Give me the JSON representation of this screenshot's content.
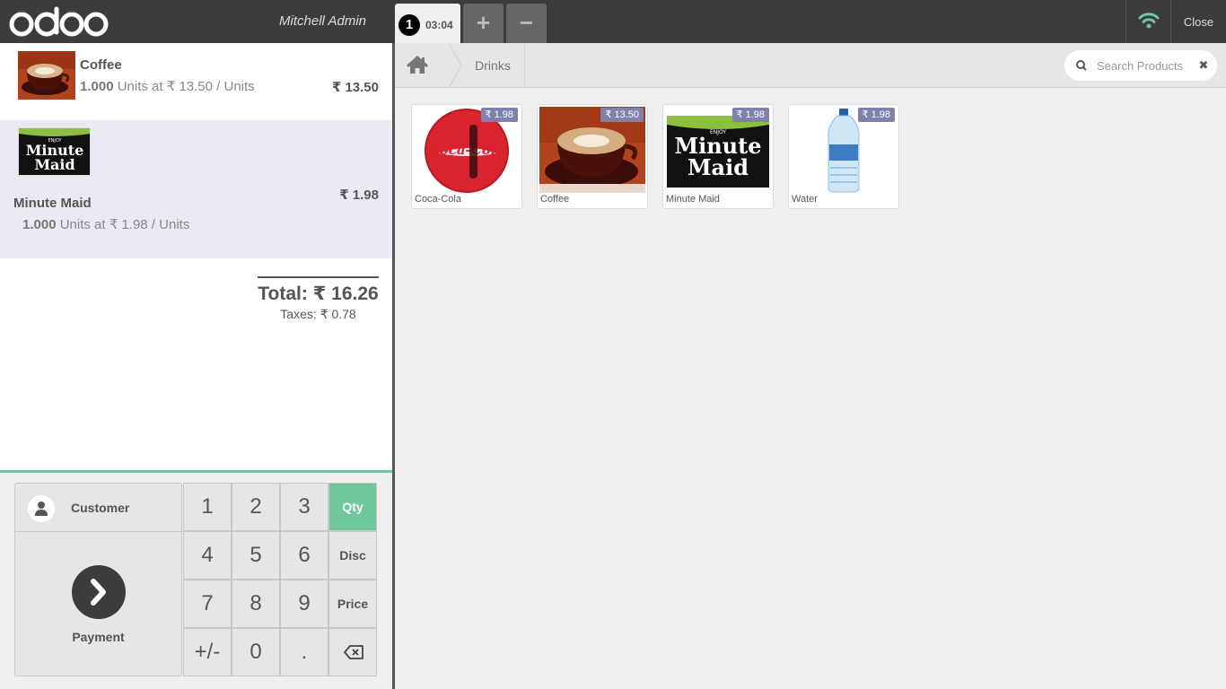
{
  "header": {
    "logo_text": "odoo",
    "user": "Mitchell Admin",
    "order_tab": {
      "number": "1",
      "time": "03:04"
    },
    "add_order": "+",
    "delete_order": "−",
    "close_label": "Close"
  },
  "orderlines": [
    {
      "name": "Coffee",
      "qty": "1.000",
      "unit_text": "Units at ₹ 13.50 / Units",
      "price": "₹ 13.50",
      "selected": false
    },
    {
      "name": "Minute Maid",
      "qty": "1.000",
      "unit_text": "Units at ₹ 1.98 / Units",
      "price": "₹ 1.98",
      "selected": true
    }
  ],
  "summary": {
    "total": "Total: ₹ 16.26",
    "taxes": "Taxes: ₹ 0.78"
  },
  "actionpad": {
    "customer_label": "Customer",
    "payment_label": "Payment"
  },
  "numpad": {
    "keys": [
      "1",
      "2",
      "3",
      "Qty",
      "4",
      "5",
      "6",
      "Disc",
      "7",
      "8",
      "9",
      "Price",
      "+/-",
      "0",
      ".",
      "⌫"
    ],
    "active_mode": "Qty"
  },
  "breadcrumb": {
    "category": "Drinks"
  },
  "search": {
    "placeholder": "Search Products",
    "clear": "✖"
  },
  "products": [
    {
      "name": "Coca-Cola",
      "price": "₹ 1.98"
    },
    {
      "name": "Coffee",
      "price": "₹ 13.50"
    },
    {
      "name": "Minute Maid",
      "price": "₹ 1.98"
    },
    {
      "name": "Water",
      "price": "₹ 1.98"
    }
  ],
  "thumb_texts": {
    "coca_cola": "Coca-Cola",
    "minute_maid_top": "ENJOY",
    "minute_maid_1": "Minute",
    "minute_maid_2": "Maid"
  },
  "colors": {
    "header_bg": "#3d3c3c",
    "accent": "#6ec89b",
    "selected_line": "#e9eaf3",
    "price_tag": "#7f82ac",
    "wifi": "#6ec89b"
  }
}
